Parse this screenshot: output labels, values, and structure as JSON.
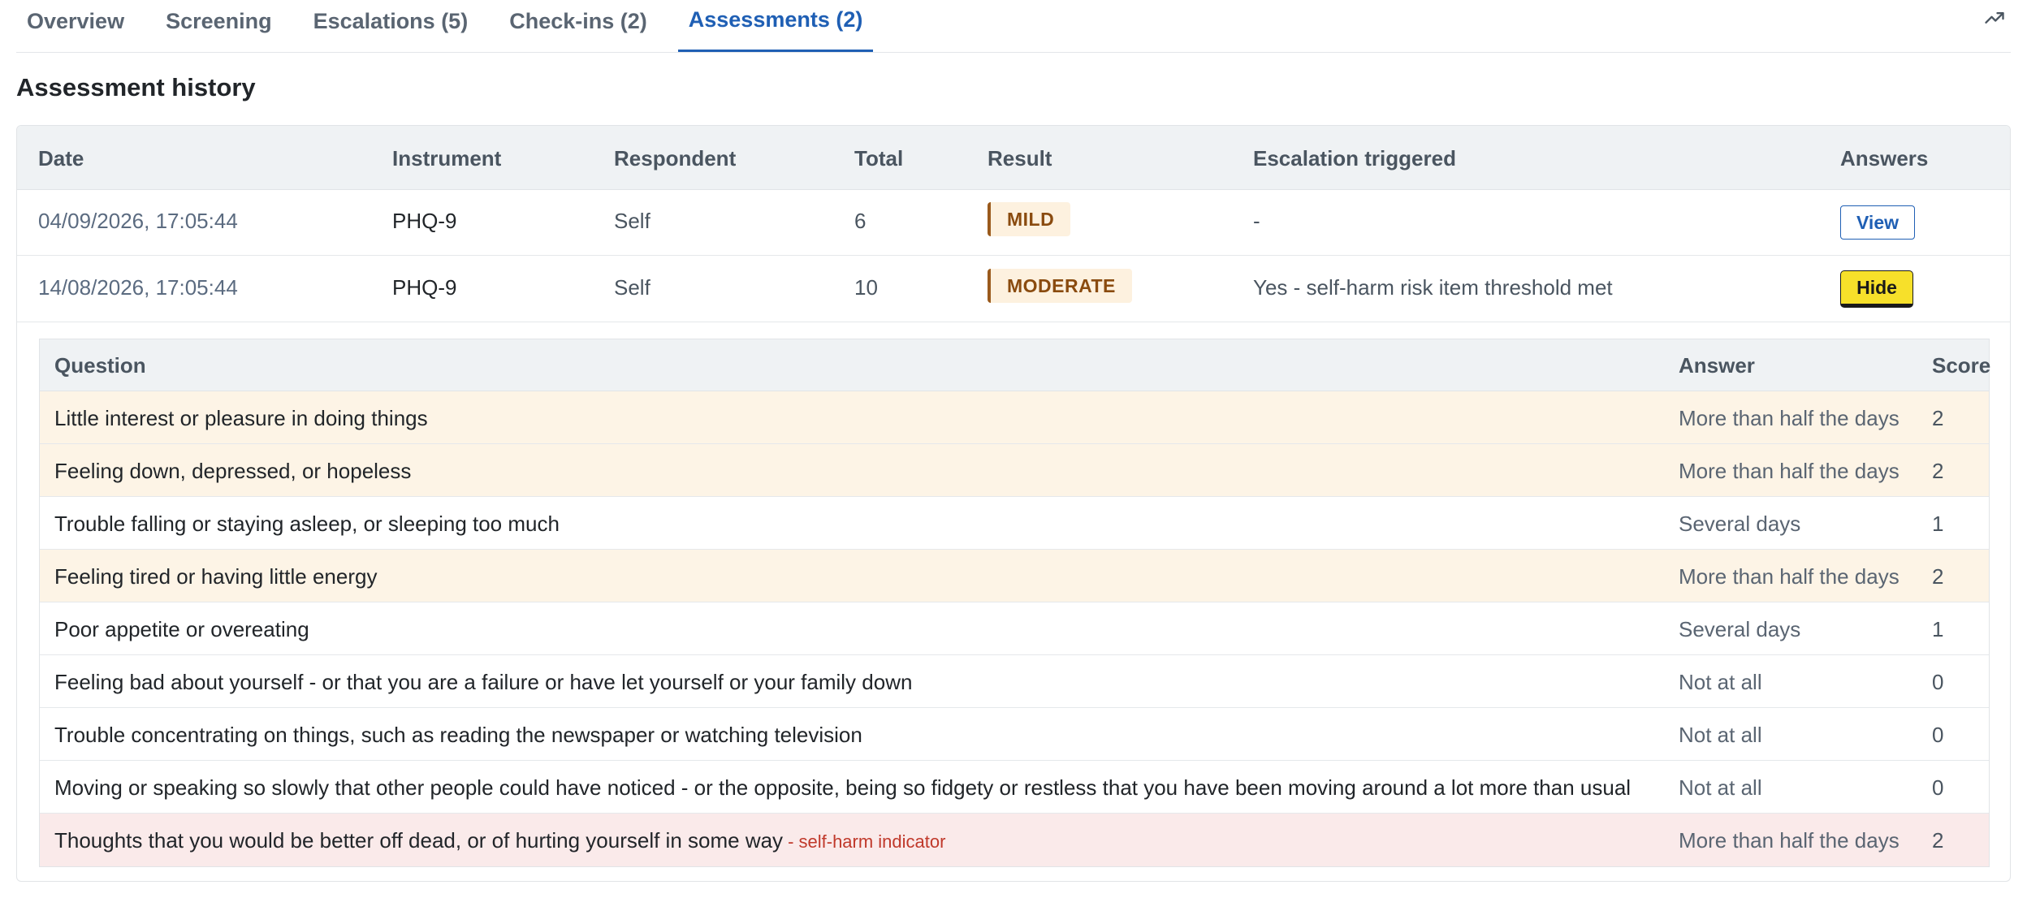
{
  "tabs": [
    {
      "label": "Overview",
      "active": false
    },
    {
      "label": "Screening",
      "active": false
    },
    {
      "label": "Escalations (5)",
      "active": false
    },
    {
      "label": "Check-ins (2)",
      "active": false
    },
    {
      "label": "Assessments (2)",
      "active": true
    }
  ],
  "icons": {
    "trend": "trending-up-icon"
  },
  "section_title": "Assessment history",
  "history": {
    "columns": [
      "Date",
      "Instrument",
      "Respondent",
      "Total",
      "Result",
      "Escalation triggered",
      "Answers"
    ],
    "rows": [
      {
        "date": "04/09/2026, 17:05:44",
        "instrument": "PHQ-9",
        "respondent": "Self",
        "total": "6",
        "result": "MILD",
        "escalation": "-",
        "action": "View"
      },
      {
        "date": "14/08/2026, 17:05:44",
        "instrument": "PHQ-9",
        "respondent": "Self",
        "total": "10",
        "result": "MODERATE",
        "escalation": "Yes - self-harm risk item threshold met",
        "action": "Hide"
      }
    ]
  },
  "answers": {
    "columns": [
      "Question",
      "Answer",
      "Score"
    ],
    "rows": [
      {
        "question": "Little interest or pleasure in doing things",
        "answer": "More than half the days",
        "score": "2",
        "style": "warn"
      },
      {
        "question": "Feeling down, depressed, or hopeless",
        "answer": "More than half the days",
        "score": "2",
        "style": "warn"
      },
      {
        "question": "Trouble falling or staying asleep, or sleeping too much",
        "answer": "Several days",
        "score": "1",
        "style": "normal"
      },
      {
        "question": "Feeling tired or having little energy",
        "answer": "More than half the days",
        "score": "2",
        "style": "warn"
      },
      {
        "question": "Poor appetite or overeating",
        "answer": "Several days",
        "score": "1",
        "style": "normal"
      },
      {
        "question": "Feeling bad about yourself - or that you are a failure or have let yourself or your family down",
        "answer": "Not at all",
        "score": "0",
        "style": "normal"
      },
      {
        "question": "Trouble concentrating on things, such as reading the newspaper or watching television",
        "answer": "Not at all",
        "score": "0",
        "style": "normal"
      },
      {
        "question": "Moving or speaking so slowly that other people could have noticed - or the opposite, being so fidgety or restless that you have been moving around a lot more than usual",
        "answer": "Not at all",
        "score": "0",
        "style": "normal"
      },
      {
        "question": "Thoughts that you would be better off dead, or of hurting yourself in some way",
        "flag": "- self-harm indicator",
        "answer": "More than half the days",
        "score": "2",
        "style": "danger"
      }
    ]
  },
  "colors": {
    "accent": "#1f5fb4",
    "warn_row": "#fdf4e6",
    "danger_row": "#faeaea",
    "badge_bg": "#fdf1df",
    "hide_button": "#f7e02a",
    "flag_text": "#c0392b"
  }
}
